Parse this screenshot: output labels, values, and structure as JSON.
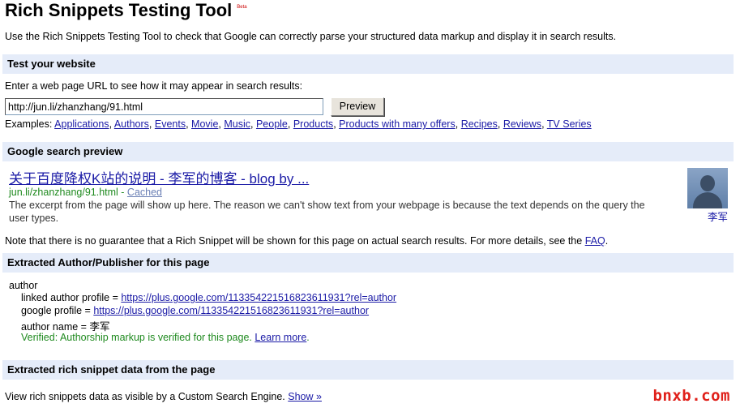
{
  "header": {
    "title": "Rich Snippets Testing Tool",
    "beta": "Beta",
    "intro": "Use the Rich Snippets Testing Tool to check that Google can correctly parse your structured data markup and display it in search results."
  },
  "test_section": {
    "heading": "Test your website",
    "prompt": "Enter a web page URL to see how it may appear in search results:",
    "url_value": "http://jun.li/zhanzhang/91.html",
    "preview_button": "Preview",
    "examples_label": "Examples:",
    "examples": [
      "Applications",
      "Authors",
      "Events",
      "Movie",
      "Music",
      "People",
      "Products",
      "Products with many offers",
      "Recipes",
      "Reviews",
      "TV Series"
    ]
  },
  "search_preview": {
    "heading": "Google search preview",
    "result_title": "关于百度降权K站的说明  - 李军的博客  - blog by ...",
    "result_url": "jun.li/zhanzhang/91.html",
    "separator": " - ",
    "cached": "Cached",
    "excerpt_line1": "The excerpt from the page will show up here. The reason we can't show text from your webpage is because the text depends on the query the",
    "excerpt_line2": "user types.",
    "author_name": "李军"
  },
  "note": {
    "text": "Note that there is no guarantee that a Rich Snippet will be shown for this page on actual search results. For more details, see the ",
    "link": "FAQ",
    "end": "."
  },
  "author_section": {
    "heading": "Extracted Author/Publisher for this page",
    "root": "author",
    "linked_label": "linked author profile = ",
    "linked_url": "https://plus.google.com/113354221516823611931?rel=author",
    "google_label": "google profile = ",
    "google_url": "https://plus.google.com/113354221516823611931?rel=author",
    "name_label": "author name = ",
    "name_value": "李军",
    "verified_text": "Verified: Authorship markup is verified for this page. ",
    "learn_more": "Learn more",
    "verified_end": "."
  },
  "rich_section": {
    "heading": "Extracted rich snippet data from the page",
    "text": "View rich snippets data as visible by a Custom Search Engine. ",
    "show_link": "Show »"
  },
  "watermark": "bnxb.com",
  "colors": {
    "bar": "#e5ecf9",
    "link": "#1a1aa6",
    "green": "#1f8a1f",
    "beta": "#cc0000"
  }
}
